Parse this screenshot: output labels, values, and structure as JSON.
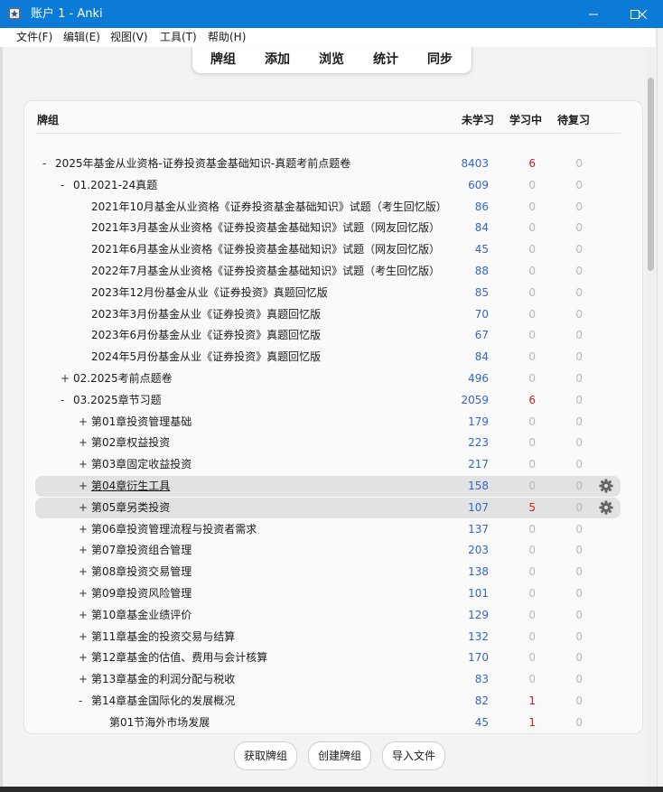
{
  "window": {
    "title": "账户 1 - Anki"
  },
  "menu": [
    "文件(F)",
    "编辑(E)",
    "视图(V)",
    "工具(T)",
    "帮助(H)"
  ],
  "toolbar": [
    "牌组",
    "添加",
    "浏览",
    "统计",
    "同步"
  ],
  "columns": {
    "deck": "牌组",
    "new": "未学习",
    "learn": "学习中",
    "due": "待复习"
  },
  "decks": [
    {
      "exp": "-",
      "name": "2025年基金从业资格-证券投资基金基础知识-真题考前点题卷",
      "new": "8403",
      "learn": "6",
      "due": "0"
    },
    {
      "exp": "-",
      "name": "01.2021-24真题",
      "new": "609",
      "learn": "0",
      "due": "0"
    },
    {
      "exp": "",
      "name": "2021年10月基金从业资格《证券投资基金基础知识》试题（考生回忆版）",
      "new": "86",
      "learn": "0",
      "due": "0"
    },
    {
      "exp": "",
      "name": "2021年3月基金从业资格《证券投资基金基础知识》试题（网友回忆版）",
      "new": "84",
      "learn": "0",
      "due": "0"
    },
    {
      "exp": "",
      "name": "2021年6月基金从业资格《证券投资基金基础知识》试题（网友回忆版）",
      "new": "45",
      "learn": "0",
      "due": "0"
    },
    {
      "exp": "",
      "name": "2022年7月基金从业资格《证券投资基金基础知识》试题（考生回忆版）",
      "new": "88",
      "learn": "0",
      "due": "0"
    },
    {
      "exp": "",
      "name": "2023年12月份基金从业《证券投资》真题回忆版",
      "new": "85",
      "learn": "0",
      "due": "0"
    },
    {
      "exp": "",
      "name": "2023年3月份基金从业《证券投资》真题回忆版",
      "new": "70",
      "learn": "0",
      "due": "0"
    },
    {
      "exp": "",
      "name": "2023年6月份基金从业《证券投资》真题回忆版",
      "new": "67",
      "learn": "0",
      "due": "0"
    },
    {
      "exp": "",
      "name": "2024年5月份基金从业《证券投资》真题回忆版",
      "new": "84",
      "learn": "0",
      "due": "0"
    },
    {
      "exp": "+",
      "name": "02.2025考前点题卷",
      "new": "496",
      "learn": "0",
      "due": "0"
    },
    {
      "exp": "-",
      "name": "03.2025章节习题",
      "new": "2059",
      "learn": "6",
      "due": "0"
    },
    {
      "exp": "+",
      "name": "第01章投资管理基础",
      "new": "179",
      "learn": "0",
      "due": "0"
    },
    {
      "exp": "+",
      "name": "第02章权益投资",
      "new": "223",
      "learn": "0",
      "due": "0"
    },
    {
      "exp": "+",
      "name": "第03章固定收益投资",
      "new": "217",
      "learn": "0",
      "due": "0"
    },
    {
      "exp": "+",
      "name": "第04章衍生工具",
      "new": "158",
      "learn": "0",
      "due": "0"
    },
    {
      "exp": "+",
      "name": "第05章另类投资",
      "new": "107",
      "learn": "5",
      "due": "0"
    },
    {
      "exp": "+",
      "name": "第06章投资管理流程与投资者需求",
      "new": "137",
      "learn": "0",
      "due": "0"
    },
    {
      "exp": "+",
      "name": "第07章投资组合管理",
      "new": "203",
      "learn": "0",
      "due": "0"
    },
    {
      "exp": "+",
      "name": "第08章投资交易管理",
      "new": "138",
      "learn": "0",
      "due": "0"
    },
    {
      "exp": "+",
      "name": "第09章投资风险管理",
      "new": "101",
      "learn": "0",
      "due": "0"
    },
    {
      "exp": "+",
      "name": "第10章基金业绩评价",
      "new": "129",
      "learn": "0",
      "due": "0"
    },
    {
      "exp": "+",
      "name": "第11章基金的投资交易与结算",
      "new": "132",
      "learn": "0",
      "due": "0"
    },
    {
      "exp": "+",
      "name": "第12章基金的估值、费用与会计核算",
      "new": "170",
      "learn": "0",
      "due": "0"
    },
    {
      "exp": "+",
      "name": "第13章基金的利润分配与税收",
      "new": "83",
      "learn": "0",
      "due": "0"
    },
    {
      "exp": "-",
      "name": "第14章基金国际化的发展概况",
      "new": "82",
      "learn": "1",
      "due": "0"
    },
    {
      "exp": "",
      "name": "第01节海外市场发展",
      "new": "45",
      "learn": "1",
      "due": "0"
    }
  ],
  "bottom_buttons": [
    "获取牌组",
    "创建牌组",
    "导入文件"
  ]
}
